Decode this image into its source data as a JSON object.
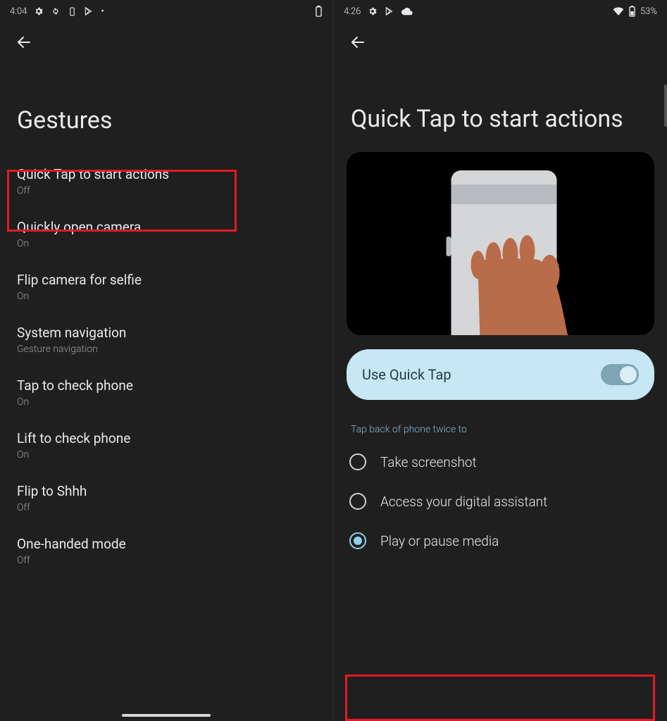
{
  "left": {
    "status": {
      "time": "4:04"
    },
    "title": "Gestures",
    "rows": [
      {
        "name": "quick-tap",
        "title": "Quick Tap to start actions",
        "sub": "Off"
      },
      {
        "name": "open-camera",
        "title": "Quickly open camera",
        "sub": "On"
      },
      {
        "name": "flip-selfie",
        "title": "Flip camera for selfie",
        "sub": "On"
      },
      {
        "name": "system-nav",
        "title": "System navigation",
        "sub": "Gesture navigation"
      },
      {
        "name": "tap-check",
        "title": "Tap to check phone",
        "sub": "On"
      },
      {
        "name": "lift-check",
        "title": "Lift to check phone",
        "sub": "On"
      },
      {
        "name": "flip-shhh",
        "title": "Flip to Shhh",
        "sub": "Off"
      },
      {
        "name": "one-handed",
        "title": "One-handed mode",
        "sub": "Off"
      }
    ]
  },
  "right": {
    "status": {
      "time": "4:26",
      "battery": "53%"
    },
    "title": "Quick Tap to start actions",
    "toggle_label": "Use Quick Tap",
    "toggle_on": true,
    "section_label": "Tap back of phone twice to",
    "options": [
      {
        "name": "opt-screenshot",
        "label": "Take screenshot",
        "checked": false
      },
      {
        "name": "opt-assistant",
        "label": "Access your digital assistant",
        "checked": false
      },
      {
        "name": "opt-media",
        "label": "Play or pause media",
        "checked": true
      }
    ]
  }
}
